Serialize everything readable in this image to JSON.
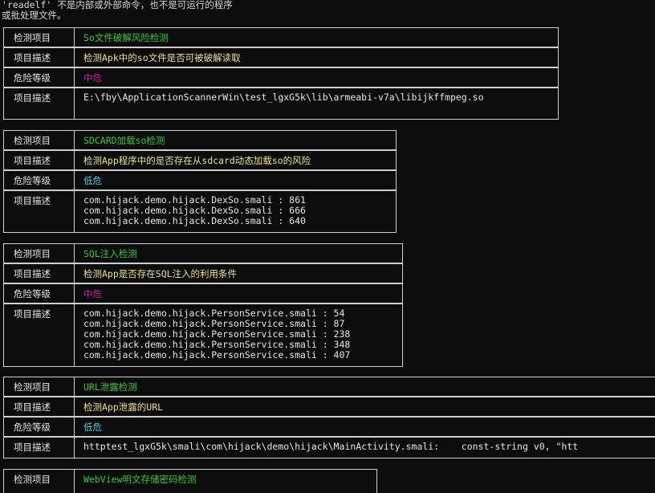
{
  "labels": {
    "check_item": "检测项目",
    "item_desc": "项目描述",
    "risk_level": "危险等级"
  },
  "error": {
    "line1": "'readelf' 不是内部或外部命令，也不是可运行的程序",
    "line2": "或批处理文件。"
  },
  "sections": [
    {
      "title": "So文件破解风险检测",
      "desc": "检测Apk中的so文件是否可被破解读取",
      "risk": "中危",
      "details": [
        "E:\\fby\\ApplicationScannerWin\\test_lgxG5k\\lib\\armeabi-v7a\\libijkffmpeg.so"
      ]
    },
    {
      "title": "SDCARD加载so检测",
      "desc": "检测App程序中的是否存在从sdcard动态加载so的风险",
      "risk": "低危",
      "details": [
        "com.hijack.demo.hijack.DexSo.smali : 861",
        "com.hijack.demo.hijack.DexSo.smali : 666",
        "com.hijack.demo.hijack.DexSo.smali : 640"
      ]
    },
    {
      "title": "SQL注入检测",
      "desc": "检测App是否存在SQL注入的利用条件",
      "risk": "中危",
      "details": [
        "com.hijack.demo.hijack.PersonService.smali : 54",
        "com.hijack.demo.hijack.PersonService.smali : 87",
        "com.hijack.demo.hijack.PersonService.smali : 238",
        "com.hijack.demo.hijack.PersonService.smali : 348",
        "com.hijack.demo.hijack.PersonService.smali : 407"
      ]
    },
    {
      "title": "URL泄露检测",
      "desc": "检测App泄露的URL",
      "risk": "低危",
      "details": [
        "httptest_lgxG5k\\smali\\com\\hijack\\demo\\hijack\\MainActivity.smali:    const-string v0, \"htt"
      ]
    },
    {
      "title": "WebView明文存储密码检测"
    }
  ],
  "colors": {
    "title": "#3ec63e",
    "desc": "#e8e09a",
    "medium_risk": "#c0289a",
    "low_risk": "#5bc7d9",
    "border": "#cfcfcf",
    "background": "#0c0c0c"
  }
}
